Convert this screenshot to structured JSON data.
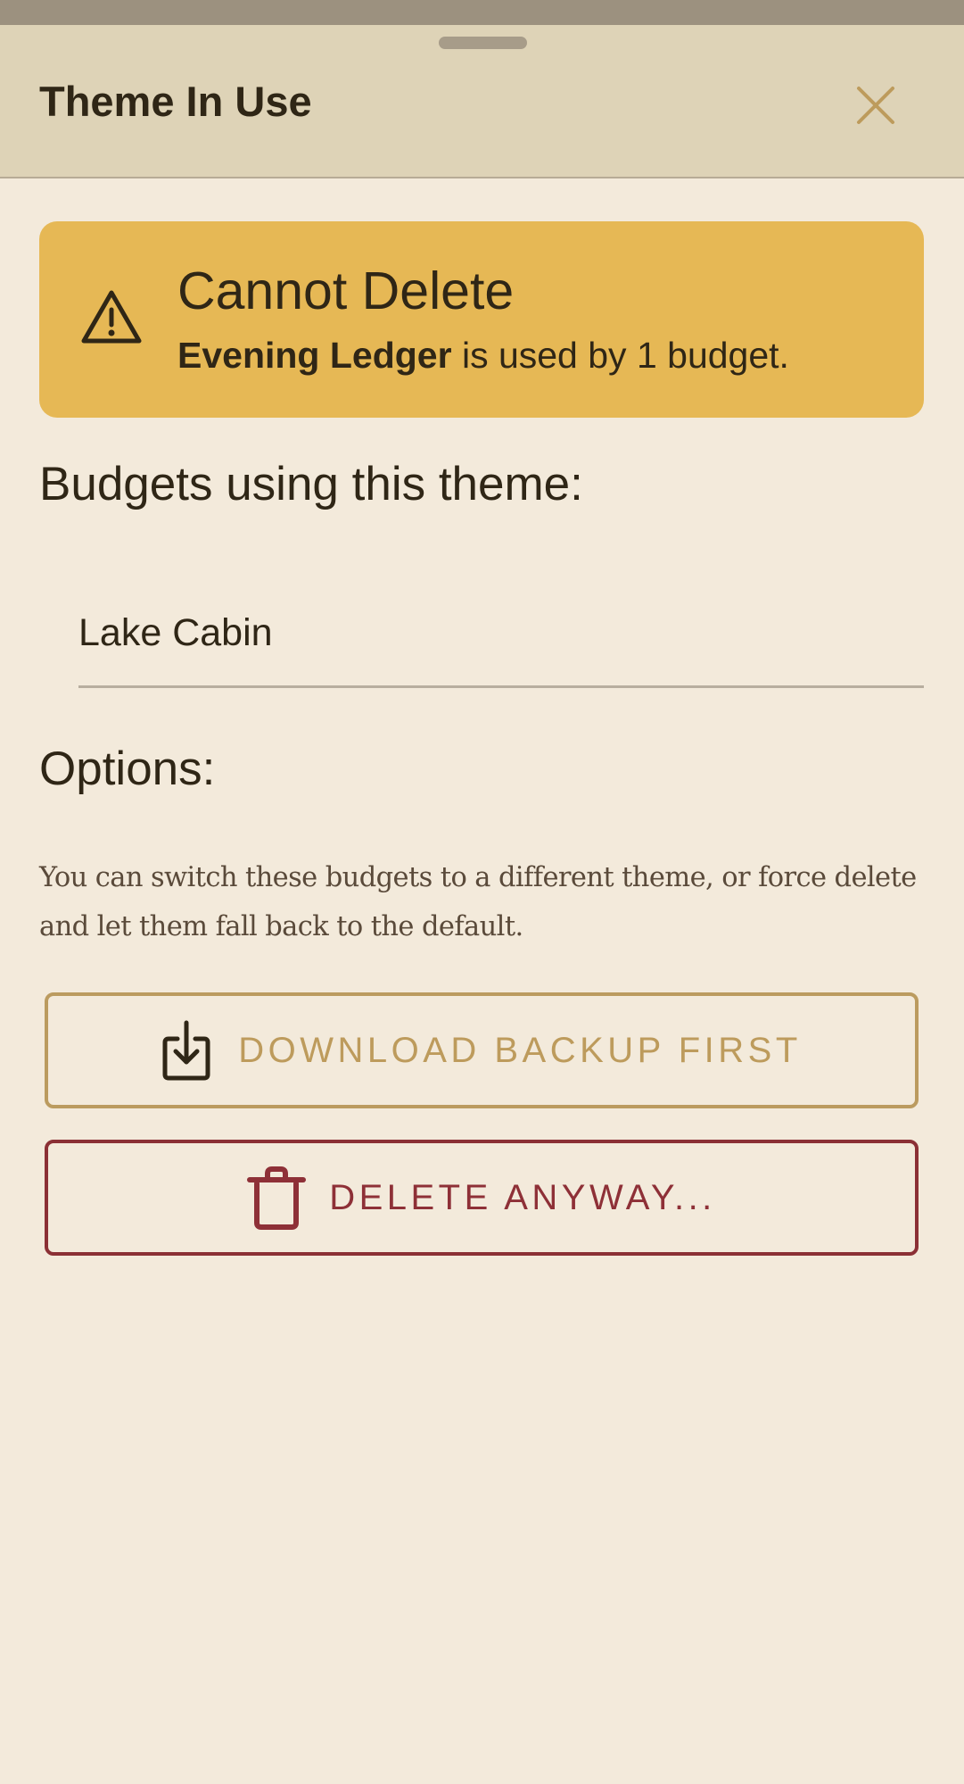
{
  "sheet": {
    "title": "Theme In Use",
    "close_icon": "close-icon"
  },
  "warning": {
    "icon": "warning-triangle-icon",
    "title": "Cannot Delete",
    "theme_name": "Evening Ledger",
    "message_suffix": " is used by 1 budget."
  },
  "budgets": {
    "heading": "Budgets using this theme:",
    "items": [
      {
        "label": "Lake Cabin"
      }
    ]
  },
  "options": {
    "heading": "Options:",
    "body": "You can switch these budgets to a different theme, or force delete and let them fall back to the default."
  },
  "actions": {
    "backup": {
      "label": "DOWNLOAD BACKUP FIRST",
      "icon": "download-icon"
    },
    "delete": {
      "label": "DELETE ANYWAY...",
      "icon": "trash-icon"
    }
  },
  "colors": {
    "background": "#f3eadb",
    "header": "#ded3b7",
    "warning": "#e6b855",
    "backup_accent": "#bd9b5c",
    "delete_accent": "#8e3037"
  }
}
